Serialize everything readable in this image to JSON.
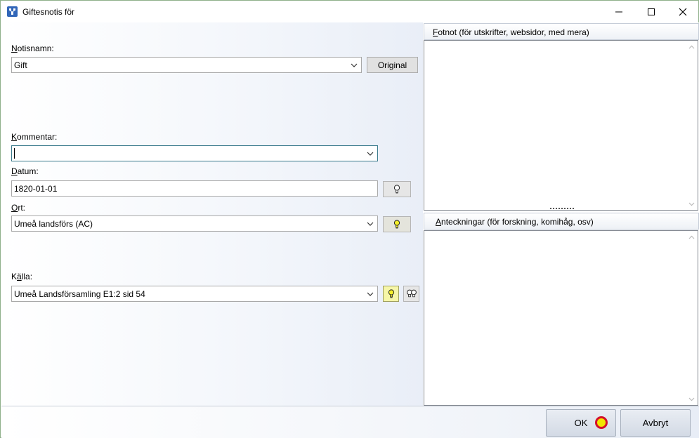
{
  "window": {
    "title": "Giftesnotis för",
    "icon": "app-family-icon",
    "controls": [
      "minimize-icon",
      "maximize-icon",
      "close-icon"
    ]
  },
  "form": {
    "notisnamn": {
      "label_first": "N",
      "label_rest": "otisnamn:",
      "value": "Gift",
      "original_button": "Original"
    },
    "kommentar": {
      "label_first": "K",
      "label_rest": "ommentar:",
      "value": ""
    },
    "datum": {
      "label_first": "D",
      "label_rest": "atum:",
      "value": "1820-01-01"
    },
    "ort": {
      "label_first": "O",
      "label_rest": "rt:",
      "value": "Umeå landsförs (AC)"
    },
    "kalla": {
      "label_first": "K",
      "label_mid": "ä",
      "label_rest": "lla:",
      "value": "Umeå Landsförsamling E1:2 sid  54"
    }
  },
  "fotnot": {
    "label_first": "F",
    "label_rest": "otnot (för utskrifter, websidor, med mera)",
    "value": ""
  },
  "anteckningar": {
    "label_first": "A",
    "label_rest": "nteckningar (för forskning, komihåg, osv)",
    "value": ""
  },
  "footer": {
    "ok_label": "OK",
    "cancel_label": "Avbryt"
  },
  "colors": {
    "focus_border": "#3a7a8c",
    "lit_bulb_bg": "#f6f6a8",
    "cursor_fill": "#f2e600",
    "cursor_ring": "#d4102a"
  }
}
